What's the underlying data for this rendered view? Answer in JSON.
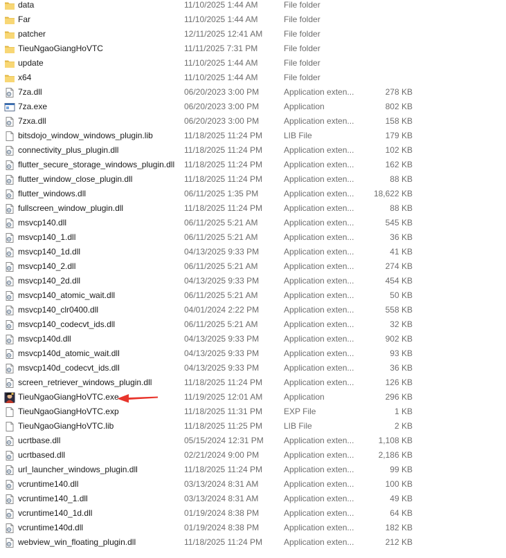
{
  "colors": {
    "folder": "#f8d775",
    "folder_dark": "#e0b441",
    "arrow": "#e8352c",
    "meta_text": "#6d6d6d"
  },
  "files": [
    {
      "name": "data",
      "date": "11/10/2025 1:44 AM",
      "type": "File folder",
      "size": "",
      "icon": "folder-icon"
    },
    {
      "name": "Far",
      "date": "11/10/2025 1:44 AM",
      "type": "File folder",
      "size": "",
      "icon": "folder-icon"
    },
    {
      "name": "patcher",
      "date": "12/11/2025 12:41 AM",
      "type": "File folder",
      "size": "",
      "icon": "folder-icon"
    },
    {
      "name": "TieuNgaoGiangHoVTC",
      "date": "11/11/2025 7:31 PM",
      "type": "File folder",
      "size": "",
      "icon": "folder-icon"
    },
    {
      "name": "update",
      "date": "11/10/2025 1:44 AM",
      "type": "File folder",
      "size": "",
      "icon": "folder-icon"
    },
    {
      "name": "x64",
      "date": "11/10/2025 1:44 AM",
      "type": "File folder",
      "size": "",
      "icon": "folder-icon"
    },
    {
      "name": "7za.dll",
      "date": "06/20/2023 3:00 PM",
      "type": "Application exten...",
      "size": "278 KB",
      "icon": "dll-icon"
    },
    {
      "name": "7za.exe",
      "date": "06/20/2023 3:00 PM",
      "type": "Application",
      "size": "802 KB",
      "icon": "exe-icon"
    },
    {
      "name": "7zxa.dll",
      "date": "06/20/2023 3:00 PM",
      "type": "Application exten...",
      "size": "158 KB",
      "icon": "dll-icon"
    },
    {
      "name": "bitsdojo_window_windows_plugin.lib",
      "date": "11/18/2025 11:24 PM",
      "type": "LIB File",
      "size": "179 KB",
      "icon": "file-icon"
    },
    {
      "name": "connectivity_plus_plugin.dll",
      "date": "11/18/2025 11:24 PM",
      "type": "Application exten...",
      "size": "102 KB",
      "icon": "dll-icon"
    },
    {
      "name": "flutter_secure_storage_windows_plugin.dll",
      "date": "11/18/2025 11:24 PM",
      "type": "Application exten...",
      "size": "162 KB",
      "icon": "dll-icon"
    },
    {
      "name": "flutter_window_close_plugin.dll",
      "date": "11/18/2025 11:24 PM",
      "type": "Application exten...",
      "size": "88 KB",
      "icon": "dll-icon"
    },
    {
      "name": "flutter_windows.dll",
      "date": "06/11/2025 1:35 PM",
      "type": "Application exten...",
      "size": "18,622 KB",
      "icon": "dll-icon"
    },
    {
      "name": "fullscreen_window_plugin.dll",
      "date": "11/18/2025 11:24 PM",
      "type": "Application exten...",
      "size": "88 KB",
      "icon": "dll-icon"
    },
    {
      "name": "msvcp140.dll",
      "date": "06/11/2025 5:21 AM",
      "type": "Application exten...",
      "size": "545 KB",
      "icon": "dll-icon"
    },
    {
      "name": "msvcp140_1.dll",
      "date": "06/11/2025 5:21 AM",
      "type": "Application exten...",
      "size": "36 KB",
      "icon": "dll-icon"
    },
    {
      "name": "msvcp140_1d.dll",
      "date": "04/13/2025 9:33 PM",
      "type": "Application exten...",
      "size": "41 KB",
      "icon": "dll-icon"
    },
    {
      "name": "msvcp140_2.dll",
      "date": "06/11/2025 5:21 AM",
      "type": "Application exten...",
      "size": "274 KB",
      "icon": "dll-icon"
    },
    {
      "name": "msvcp140_2d.dll",
      "date": "04/13/2025 9:33 PM",
      "type": "Application exten...",
      "size": "454 KB",
      "icon": "dll-icon"
    },
    {
      "name": "msvcp140_atomic_wait.dll",
      "date": "06/11/2025 5:21 AM",
      "type": "Application exten...",
      "size": "50 KB",
      "icon": "dll-icon"
    },
    {
      "name": "msvcp140_clr0400.dll",
      "date": "04/01/2024 2:22 PM",
      "type": "Application exten...",
      "size": "558 KB",
      "icon": "dll-icon"
    },
    {
      "name": "msvcp140_codecvt_ids.dll",
      "date": "06/11/2025 5:21 AM",
      "type": "Application exten...",
      "size": "32 KB",
      "icon": "dll-icon"
    },
    {
      "name": "msvcp140d.dll",
      "date": "04/13/2025 9:33 PM",
      "type": "Application exten...",
      "size": "902 KB",
      "icon": "dll-icon"
    },
    {
      "name": "msvcp140d_atomic_wait.dll",
      "date": "04/13/2025 9:33 PM",
      "type": "Application exten...",
      "size": "93 KB",
      "icon": "dll-icon"
    },
    {
      "name": "msvcp140d_codecvt_ids.dll",
      "date": "04/13/2025 9:33 PM",
      "type": "Application exten...",
      "size": "36 KB",
      "icon": "dll-icon"
    },
    {
      "name": "screen_retriever_windows_plugin.dll",
      "date": "11/18/2025 11:24 PM",
      "type": "Application exten...",
      "size": "126 KB",
      "icon": "dll-icon"
    },
    {
      "name": "TieuNgaoGiangHoVTC.exe",
      "date": "11/19/2025 12:01 AM",
      "type": "Application",
      "size": "296 KB",
      "icon": "game-exe-icon"
    },
    {
      "name": "TieuNgaoGiangHoVTC.exp",
      "date": "11/18/2025 11:31 PM",
      "type": "EXP File",
      "size": "1 KB",
      "icon": "file-icon"
    },
    {
      "name": "TieuNgaoGiangHoVTC.lib",
      "date": "11/18/2025 11:25 PM",
      "type": "LIB File",
      "size": "2 KB",
      "icon": "file-icon"
    },
    {
      "name": "ucrtbase.dll",
      "date": "05/15/2024 12:31 PM",
      "type": "Application exten...",
      "size": "1,108 KB",
      "icon": "dll-icon"
    },
    {
      "name": "ucrtbased.dll",
      "date": "02/21/2024 9:00 PM",
      "type": "Application exten...",
      "size": "2,186 KB",
      "icon": "dll-icon"
    },
    {
      "name": "url_launcher_windows_plugin.dll",
      "date": "11/18/2025 11:24 PM",
      "type": "Application exten...",
      "size": "99 KB",
      "icon": "dll-icon"
    },
    {
      "name": "vcruntime140.dll",
      "date": "03/13/2024 8:31 AM",
      "type": "Application exten...",
      "size": "100 KB",
      "icon": "dll-icon"
    },
    {
      "name": "vcruntime140_1.dll",
      "date": "03/13/2024 8:31 AM",
      "type": "Application exten...",
      "size": "49 KB",
      "icon": "dll-icon"
    },
    {
      "name": "vcruntime140_1d.dll",
      "date": "01/19/2024 8:38 PM",
      "type": "Application exten...",
      "size": "64 KB",
      "icon": "dll-icon"
    },
    {
      "name": "vcruntime140d.dll",
      "date": "01/19/2024 8:38 PM",
      "type": "Application exten...",
      "size": "182 KB",
      "icon": "dll-icon"
    },
    {
      "name": "webview_win_floating_plugin.dll",
      "date": "11/18/2025 11:24 PM",
      "type": "Application exten...",
      "size": "212 KB",
      "icon": "dll-icon"
    }
  ]
}
